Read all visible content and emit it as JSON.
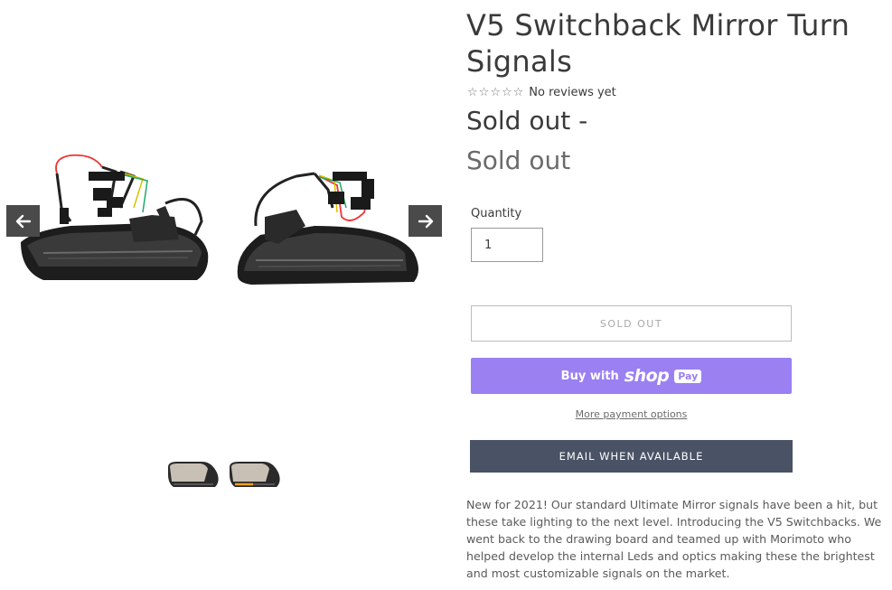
{
  "product": {
    "title": "V5 Switchback Mirror Turn Signals",
    "reviews_text": "No reviews yet",
    "stars": [
      "☆",
      "☆",
      "☆",
      "☆",
      "☆"
    ],
    "price_sale": "Sold out -",
    "price_regular": "Sold out",
    "quantity_label": "Quantity",
    "quantity_value": "1",
    "soldout_button": "SOLD OUT",
    "shoppay": {
      "buy_with": "Buy with",
      "shop": "shop",
      "pay": "Pay"
    },
    "more_payment": "More payment options",
    "email_button": "EMAIL WHEN AVAILABLE",
    "description": "New for 2021! Our standard Ultimate Mirror signals have been a hit, but these take lighting to the next level. Introducing the V5 Switchbacks. We went back to the drawing board and teamed up with Morimoto who helped develop the internal Leds and optics making these the brightest and most customizable signals on the market."
  },
  "gallery": {
    "prev_icon": "arrow-left-icon",
    "next_icon": "arrow-right-icon",
    "thumbnail_count": 2
  },
  "colors": {
    "shoppay": "#9b80f2",
    "email_button": "#4a5365",
    "arrow_bg": "#4a4a4a"
  }
}
